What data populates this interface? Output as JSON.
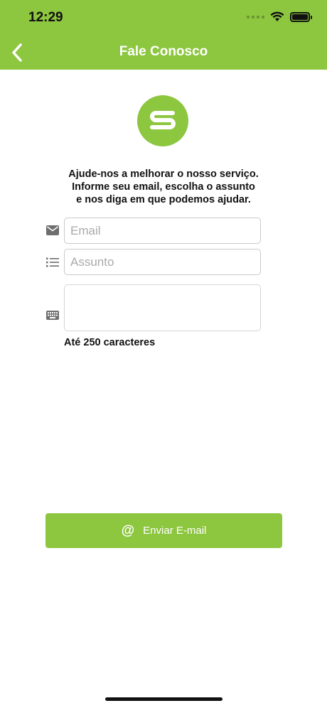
{
  "status_bar": {
    "time": "12:29"
  },
  "nav": {
    "title": "Fale Conosco"
  },
  "intro": {
    "line1": "Ajude-nos a melhorar o nosso serviço.",
    "line2": "Informe seu email, escolha o assunto",
    "line3": "e nos diga em que podemos ajudar."
  },
  "form": {
    "email_placeholder": "Email",
    "email_value": "",
    "subject_placeholder": "Assunto",
    "subject_value": "",
    "message_value": "",
    "char_limit": "Até 250 caracteres"
  },
  "send_button": {
    "label": "Enviar E-mail"
  },
  "icons": {
    "back": "chevron-left-icon",
    "email": "envelope-icon",
    "subject": "list-icon",
    "message": "keyboard-icon",
    "send": "at-icon"
  },
  "colors": {
    "accent": "#8dc63f",
    "icon_gray": "#6e6e6e"
  }
}
